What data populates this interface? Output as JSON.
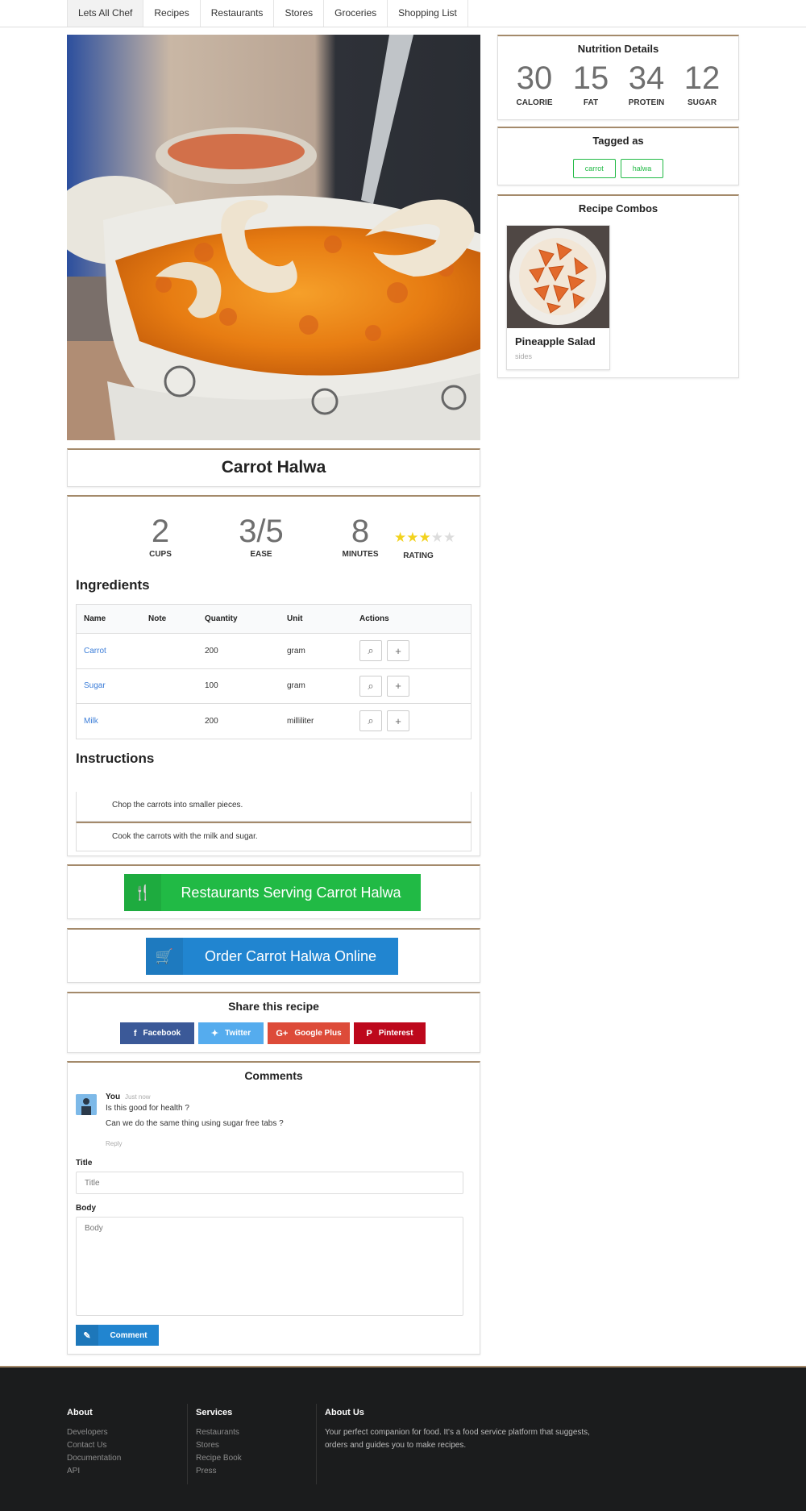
{
  "nav": {
    "items": [
      "Lets All Chef",
      "Recipes",
      "Restaurants",
      "Stores",
      "Groceries",
      "Shopping List"
    ]
  },
  "recipe": {
    "title": "Carrot Halwa",
    "stats": [
      {
        "value": "2",
        "label": "CUPS"
      },
      {
        "value": "3/5",
        "label": "EASE"
      },
      {
        "value": "8",
        "label": "MINUTES"
      }
    ],
    "rating": {
      "label": "RATING",
      "value": 3,
      "max": 5
    }
  },
  "ingredients": {
    "heading": "Ingredients",
    "columns": [
      "Name",
      "Note",
      "Quantity",
      "Unit",
      "Actions"
    ],
    "rows": [
      {
        "name": "Carrot",
        "note": "",
        "quantity": "200",
        "unit": "gram"
      },
      {
        "name": "Sugar",
        "note": "",
        "quantity": "100",
        "unit": "gram"
      },
      {
        "name": "Milk",
        "note": "",
        "quantity": "200",
        "unit": "milliliter"
      }
    ]
  },
  "instructions": {
    "heading": "Instructions",
    "steps": [
      "Chop the carrots into smaller pieces.",
      "Cook the carrots with the milk and sugar."
    ]
  },
  "cta": {
    "restaurants_label": "Restaurants Serving Carrot Halwa",
    "order_label": "Order Carrot Halwa Online"
  },
  "share": {
    "heading": "Share this recipe",
    "buttons": [
      {
        "label": "Facebook",
        "color": "#3b5998"
      },
      {
        "label": "Twitter",
        "color": "#55acee"
      },
      {
        "label": "Google Plus",
        "color": "#dd4b39"
      },
      {
        "label": "Pinterest",
        "color": "#bd081c"
      }
    ]
  },
  "comments": {
    "heading": "Comments",
    "items": [
      {
        "author": "You",
        "time": "Just now",
        "lines": [
          "Is this good for health ?",
          "Can we do the same thing using sugar free tabs ?"
        ],
        "reply": "Reply"
      }
    ],
    "form": {
      "title_label": "Title",
      "title_placeholder": "Title",
      "body_label": "Body",
      "body_placeholder": "Body",
      "submit_label": "Comment"
    }
  },
  "nutrition": {
    "heading": "Nutrition Details",
    "items": [
      {
        "value": "30",
        "label": "CALORIE"
      },
      {
        "value": "15",
        "label": "FAT"
      },
      {
        "value": "34",
        "label": "PROTEIN"
      },
      {
        "value": "12",
        "label": "SUGAR"
      }
    ]
  },
  "tags": {
    "heading": "Tagged as",
    "items": [
      "carrot",
      "halwa"
    ]
  },
  "combos": {
    "heading": "Recipe Combos",
    "items": [
      {
        "title": "Pineapple Salad",
        "category": "sides"
      }
    ]
  },
  "footer": {
    "about": {
      "heading": "About",
      "links": [
        "Developers",
        "Contact Us",
        "Documentation",
        "API"
      ]
    },
    "services": {
      "heading": "Services",
      "links": [
        "Restaurants",
        "Stores",
        "Recipe Book",
        "Press"
      ]
    },
    "about_us": {
      "heading": "About Us",
      "text": "Your perfect companion for food. It's a food service platform that suggests, orders and guides you to make recipes."
    }
  },
  "colors": {
    "accent_border": "#a48a6b",
    "restaurants_button": "#21ba45",
    "order_button": "#2185d0",
    "link": "#3b7dd8",
    "star": "#f2d21d"
  }
}
